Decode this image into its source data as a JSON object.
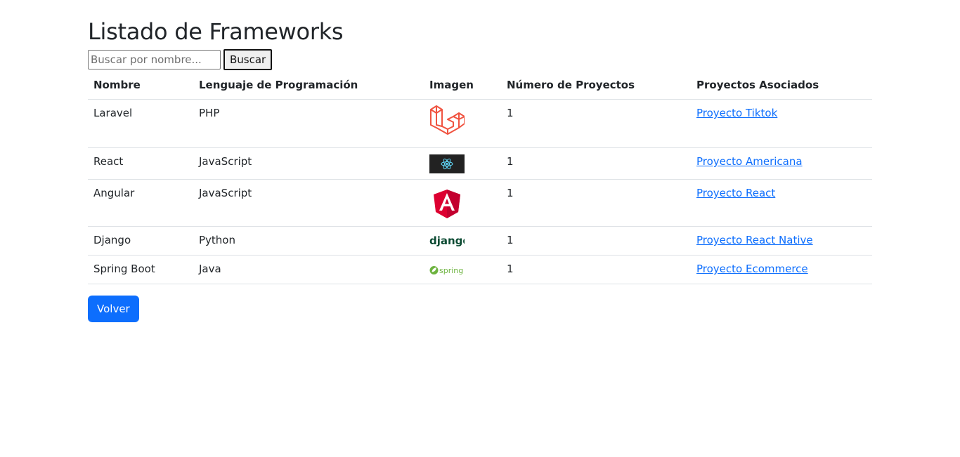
{
  "page": {
    "title": "Listado de Frameworks"
  },
  "search": {
    "placeholder": "Buscar por nombre...",
    "value": "",
    "button_label": "Buscar"
  },
  "table": {
    "headers": [
      "Nombre",
      "Lenguaje de Programación",
      "Imagen",
      "Número de Proyectos",
      "Proyectos Asociados"
    ],
    "rows": [
      {
        "name": "Laravel",
        "language": "PHP",
        "logo": "laravel-logo",
        "count": "1",
        "project": "Proyecto Tiktok"
      },
      {
        "name": "React",
        "language": "JavaScript",
        "logo": "react-logo",
        "count": "1",
        "project": "Proyecto Americana"
      },
      {
        "name": "Angular",
        "language": "JavaScript",
        "logo": "angular-logo",
        "count": "1",
        "project": "Proyecto React"
      },
      {
        "name": "Django",
        "language": "Python",
        "logo": "django-logo",
        "logo_text": "django",
        "count": "1",
        "project": "Proyecto React Native"
      },
      {
        "name": "Spring Boot",
        "language": "Java",
        "logo": "spring-logo",
        "logo_text": "spring",
        "count": "1",
        "project": "Proyecto Ecommerce"
      }
    ]
  },
  "footer": {
    "back_label": "Volver"
  },
  "colors": {
    "primary": "#0d6efd",
    "laravel": "#f05340",
    "angular": "#dd0031",
    "django": "#0c4b33",
    "spring": "#6db33f",
    "react_bg": "#222222",
    "react": "#61dafb"
  }
}
